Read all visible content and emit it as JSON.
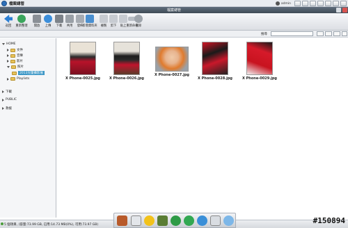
{
  "app": {
    "title": "檔案總管",
    "user": "admin"
  },
  "window": {
    "title": "檔案總管"
  },
  "toolbar": {
    "tools": [
      {
        "label": "返回"
      },
      {
        "label": "重新整理"
      },
      {
        "label": "開啟"
      },
      {
        "label": "上傳"
      },
      {
        "label": "下載"
      },
      {
        "label": "共用"
      },
      {
        "label": "發佈"
      },
      {
        "label": "新增資料夾"
      },
      {
        "label": "複製"
      },
      {
        "label": "剪下"
      },
      {
        "label": "貼上"
      },
      {
        "label": "重新命名"
      },
      {
        "label": "刪除"
      }
    ]
  },
  "search": {
    "label": "搜尋",
    "placeholder": ""
  },
  "sidebar": {
    "home": "HOME",
    "items": [
      {
        "label": "文件"
      },
      {
        "label": "音樂"
      },
      {
        "label": "影片"
      },
      {
        "label": "照片"
      }
    ],
    "selected": "2013兒童攝影展",
    "playlists": "Playlists",
    "download": "下載",
    "public": "PUBLIC",
    "recycle": "救援"
  },
  "files": [
    {
      "name": "X Phone-0025.jpg"
    },
    {
      "name": "X Phone-0026.jpg"
    },
    {
      "name": "X Phone-0027.jpg"
    },
    {
      "name": "X Phone-0028.jpg"
    },
    {
      "name": "X Phone-0029.jpg"
    }
  ],
  "status": {
    "text": "5 個項目, (容量:73.99 GB, 已用:14.73 MB(0%), 可用:73.97 GB)"
  },
  "watermark": "#150894"
}
